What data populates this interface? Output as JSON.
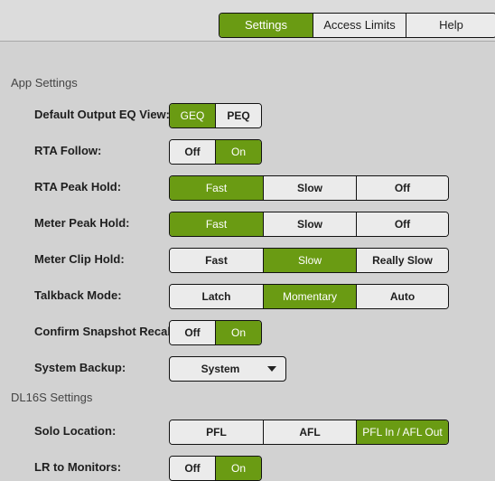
{
  "tabs": [
    {
      "label": "Settings",
      "active": true
    },
    {
      "label": "Access Limits",
      "active": false
    },
    {
      "label": "Help",
      "active": false
    }
  ],
  "sections": {
    "app": "App Settings",
    "dl16s": "DL16S Settings"
  },
  "rows": {
    "default_output_eq_view": {
      "label": "Default Output EQ View:",
      "options": [
        "GEQ",
        "PEQ"
      ],
      "selected": "GEQ"
    },
    "rta_follow": {
      "label": "RTA Follow:",
      "options": [
        "Off",
        "On"
      ],
      "selected": "On"
    },
    "rta_peak_hold": {
      "label": "RTA Peak Hold:",
      "options": [
        "Fast",
        "Slow",
        "Off"
      ],
      "selected": "Fast"
    },
    "meter_peak_hold": {
      "label": "Meter Peak Hold:",
      "options": [
        "Fast",
        "Slow",
        "Off"
      ],
      "selected": "Fast"
    },
    "meter_clip_hold": {
      "label": "Meter Clip Hold:",
      "options": [
        "Fast",
        "Slow",
        "Really Slow"
      ],
      "selected": "Slow"
    },
    "talkback_mode": {
      "label": "Talkback Mode:",
      "options": [
        "Latch",
        "Momentary",
        "Auto"
      ],
      "selected": "Momentary"
    },
    "confirm_snapshot_recall": {
      "label": "Confirm Snapshot Recall:",
      "options": [
        "Off",
        "On"
      ],
      "selected": "On"
    },
    "system_backup": {
      "label": "System Backup:",
      "value": "System"
    },
    "solo_location": {
      "label": "Solo Location:",
      "options": [
        "PFL",
        "AFL",
        "PFL In / AFL Out"
      ],
      "selected": "PFL In / AFL Out"
    },
    "lr_to_monitors": {
      "label": "LR to Monitors:",
      "options": [
        "Off",
        "On"
      ],
      "selected": "On"
    }
  },
  "colors": {
    "accent": "#6a9b13",
    "background": "#d2d2d2",
    "button": "#ebebeb"
  }
}
